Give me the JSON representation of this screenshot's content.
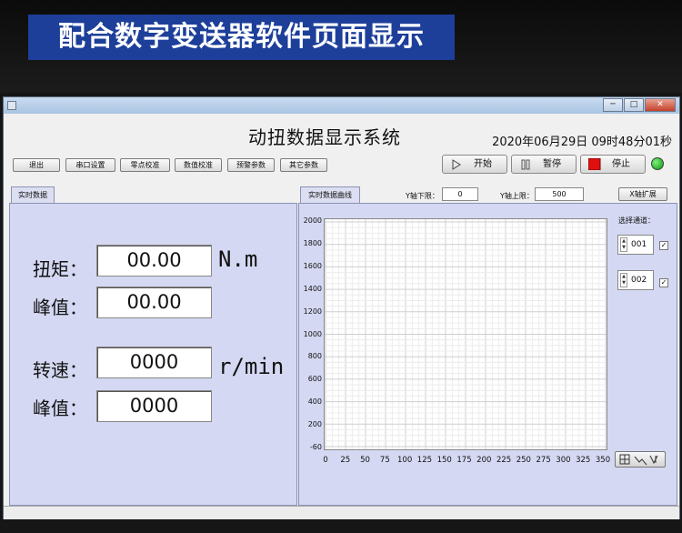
{
  "banner": {
    "text": "配合数字变送器软件页面显示"
  },
  "app": {
    "title": "动扭数据显示系统",
    "datetime": "2020年06月29日  09时48分01秒"
  },
  "toolbar": {
    "items": [
      "退出",
      "串口设置",
      "零点校准",
      "数值校准",
      "预警参数",
      "其它参数"
    ]
  },
  "controls": {
    "start": "开始",
    "pause": "暂停",
    "stop": "停止",
    "led_color": "#1aa01a"
  },
  "left_panel": {
    "tab": "实时数据",
    "torque_label": "扭矩：",
    "torque_value": "00.00",
    "torque_unit": "N.m",
    "torque_peak_label": "峰值：",
    "torque_peak_value": "00.00",
    "speed_label": "转速：",
    "speed_value": "0000",
    "speed_unit": "r/min",
    "speed_peak_label": "峰值：",
    "speed_peak_value": "0000"
  },
  "right_panel": {
    "tab": "实时数据曲线",
    "y_min_label": "Y轴下限：",
    "y_min_value": "0",
    "y_max_label": "Y轴上限：",
    "y_max_value": "500",
    "x_expand": "X轴扩展",
    "channel_label": "选择通道：",
    "channels": [
      {
        "value": "001",
        "checked": "✓"
      },
      {
        "value": "002",
        "checked": "✓"
      }
    ]
  },
  "chart_data": {
    "type": "line",
    "title": "",
    "xlabel": "",
    "ylabel": "",
    "xlim": [
      0,
      350
    ],
    "ylim": [
      -60,
      2000
    ],
    "x_ticks": [
      "0",
      "25",
      "50",
      "75",
      "100",
      "125",
      "150",
      "175",
      "200",
      "225",
      "250",
      "275",
      "300",
      "325",
      "350"
    ],
    "y_ticks": [
      "2000",
      "1800",
      "1600",
      "1400",
      "1200",
      "1000",
      "800",
      "600",
      "400",
      "200",
      "-60"
    ],
    "grid": true,
    "series": []
  }
}
